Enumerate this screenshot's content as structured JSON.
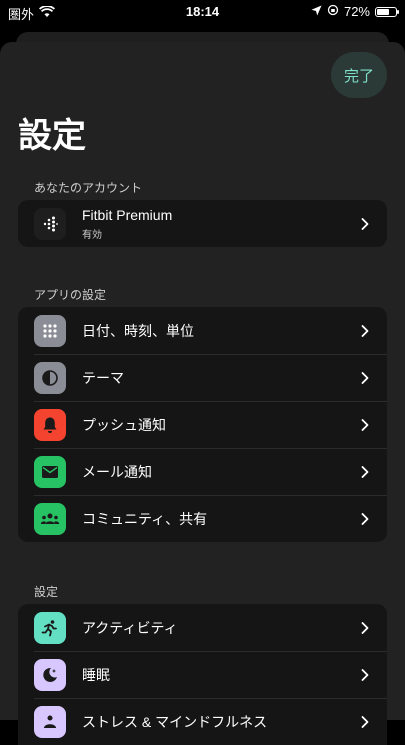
{
  "status_bar": {
    "carrier": "圏外",
    "time": "18:14",
    "battery_percent": "72%",
    "battery_level": 0.72
  },
  "header": {
    "done_label": "完了",
    "title": "設定"
  },
  "sections": {
    "account": {
      "header": "あなたのアカウント",
      "items": [
        {
          "label": "Fitbit Premium",
          "sublabel": "有効",
          "icon": "fitbit-logo-icon"
        }
      ]
    },
    "app": {
      "header": "アプリの設定",
      "items": [
        {
          "label": "日付、時刻、単位",
          "icon": "grid-dots-icon",
          "color": "#8a8d96"
        },
        {
          "label": "テーマ",
          "icon": "contrast-icon",
          "color": "#8a8d96"
        },
        {
          "label": "プッシュ通知",
          "icon": "bell-icon",
          "color": "#f4432f"
        },
        {
          "label": "メール通知",
          "icon": "mail-icon",
          "color": "#27c264"
        },
        {
          "label": "コミュニティ、共有",
          "icon": "people-icon",
          "color": "#27c264"
        }
      ]
    },
    "settings": {
      "header": "設定",
      "items": [
        {
          "label": "アクティビティ",
          "icon": "running-icon",
          "color": "#63e0c4"
        },
        {
          "label": "睡眠",
          "icon": "moon-icon",
          "color": "#d8c6ff"
        },
        {
          "label": "ストレス & マインドフルネス",
          "icon": "person-icon",
          "color": "#d8c6ff"
        }
      ]
    }
  }
}
